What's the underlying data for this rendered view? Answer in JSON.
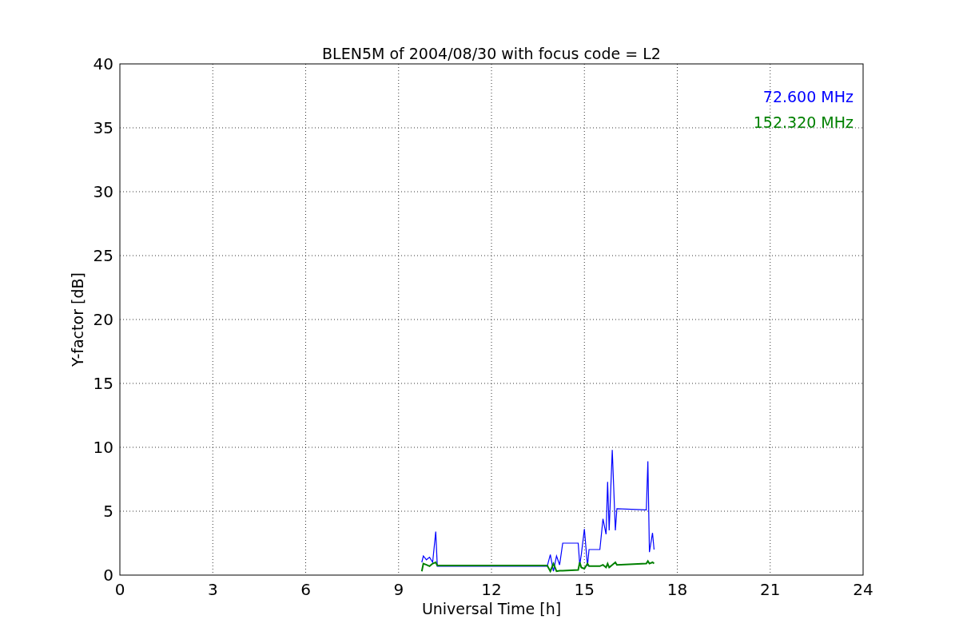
{
  "chart_data": {
    "type": "line",
    "title": "BLEN5M of 2004/08/30 with focus code = L2",
    "xlabel": "Universal Time [h]",
    "ylabel": "Y-factor [dB]",
    "x": [
      9.75,
      9.8,
      9.9,
      10.0,
      10.1,
      10.2,
      10.25,
      13.8,
      13.9,
      14.0,
      14.1,
      14.2,
      14.3,
      14.8,
      14.85,
      14.9,
      15.0,
      15.1,
      15.15,
      15.5,
      15.6,
      15.7,
      15.75,
      15.8,
      15.9,
      16.0,
      16.05,
      17.0,
      17.05,
      17.1,
      17.2,
      17.25
    ],
    "series": [
      {
        "name": "72.600 MHz",
        "color": "#0000ff",
        "values": [
          1.0,
          1.5,
          1.2,
          1.4,
          1.0,
          3.4,
          0.7,
          0.7,
          1.6,
          0.3,
          1.5,
          0.8,
          2.5,
          2.5,
          0.8,
          1.6,
          3.6,
          0.7,
          2.0,
          2.0,
          4.4,
          3.2,
          7.3,
          3.5,
          9.8,
          3.5,
          5.2,
          5.1,
          8.9,
          1.8,
          3.3,
          2.0
        ]
      },
      {
        "name": "152.320 MHz",
        "color": "#008000",
        "values": [
          0.3,
          0.9,
          0.8,
          0.7,
          0.9,
          1.0,
          0.75,
          0.75,
          0.3,
          0.9,
          0.3,
          0.35,
          0.35,
          0.4,
          1.0,
          0.6,
          0.5,
          0.9,
          0.7,
          0.7,
          0.8,
          0.6,
          0.9,
          0.6,
          0.8,
          1.0,
          0.8,
          0.9,
          1.1,
          0.9,
          1.0,
          0.9
        ]
      }
    ],
    "grid": true,
    "xlim": [
      0,
      24
    ],
    "ylim": [
      0,
      40
    ],
    "xticks": [
      0,
      3,
      6,
      9,
      12,
      15,
      18,
      21,
      24
    ],
    "yticks": [
      0,
      5,
      10,
      15,
      20,
      25,
      30,
      35,
      40
    ]
  }
}
